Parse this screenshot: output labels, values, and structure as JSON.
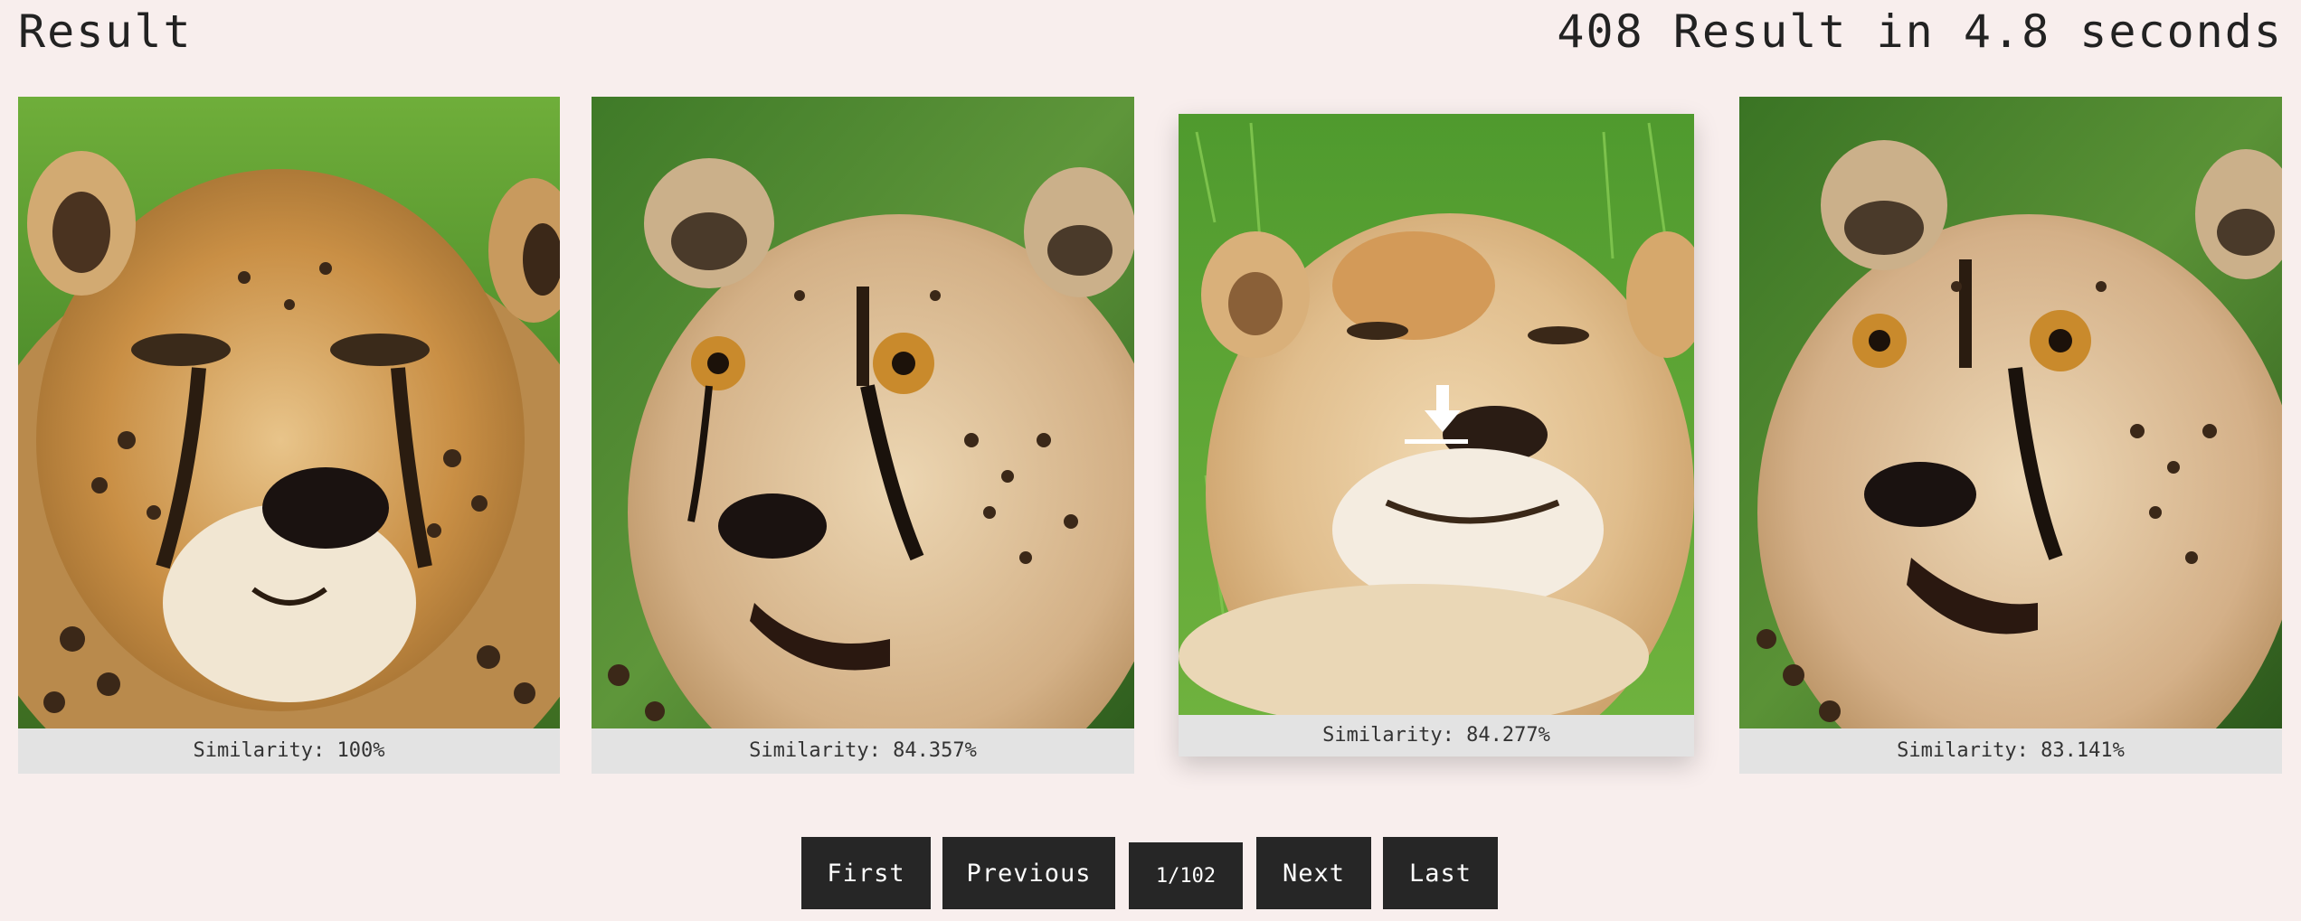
{
  "header": {
    "title": "Result",
    "stats": "408 Result in 4.8 seconds"
  },
  "results": [
    {
      "similarity_label": "Similarity: 100%",
      "subject": "cheetah"
    },
    {
      "similarity_label": "Similarity: 84.357%",
      "subject": "cheetah"
    },
    {
      "similarity_label": "Similarity: 84.277%",
      "subject": "lioness"
    },
    {
      "similarity_label": "Similarity: 83.141%",
      "subject": "cheetah"
    }
  ],
  "pagination": {
    "first_label": "First",
    "previous_label": "Previous",
    "page_indicator": "1/102",
    "next_label": "Next",
    "last_label": "Last"
  },
  "icons": {
    "download": "download-icon"
  },
  "colors": {
    "background": "#f8eeed",
    "button": "#262626",
    "caption_bg": "#e3e3e3"
  }
}
